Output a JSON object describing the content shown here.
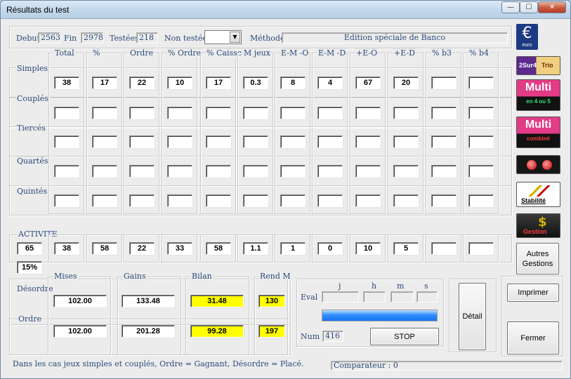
{
  "window": {
    "title": "Résultats du test",
    "min": "—",
    "max": "☐",
    "close": "✕"
  },
  "header": {
    "debut_label": "Debut",
    "debut": "2563",
    "fin_label": "Fin",
    "fin": "2978",
    "testees_label": "Testées",
    "testees": "218",
    "non_testees_label": "Non testées",
    "non_testees_value": "",
    "methode_label": "Méthode",
    "methode": "Edition spéciale de Banco"
  },
  "columns": [
    "Total",
    "%",
    "Ordre",
    "% Ordre",
    "% Caisse",
    "M jeux",
    "E-M -O",
    "E-M -D",
    "+E-O",
    "+E-D",
    "% b3",
    "% b4"
  ],
  "rows": [
    {
      "label": "Simples",
      "values": [
        "38",
        "17",
        "22",
        "10",
        "17",
        "0.3",
        "8",
        "4",
        "67",
        "20",
        "",
        ""
      ]
    },
    {
      "label": "Couplés",
      "values": [
        "",
        "",
        "",
        "",
        "",
        "",
        "",
        "",
        "",
        "",
        "",
        ""
      ]
    },
    {
      "label": "Tiercés",
      "values": [
        "",
        "",
        "",
        "",
        "",
        "",
        "",
        "",
        "",
        "",
        "",
        ""
      ]
    },
    {
      "label": "Quartés",
      "values": [
        "",
        "",
        "",
        "",
        "",
        "",
        "",
        "",
        "",
        "",
        "",
        ""
      ]
    },
    {
      "label": "Quintés",
      "values": [
        "",
        "",
        "",
        "",
        "",
        "",
        "",
        "",
        "",
        "",
        "",
        ""
      ]
    }
  ],
  "activite": {
    "label": "ACTIVITE",
    "count": "65",
    "pct": "15%",
    "values": [
      "38",
      "58",
      "22",
      "33",
      "58",
      "1.1",
      "1",
      "0",
      "10",
      "5",
      "",
      ""
    ]
  },
  "bottom": {
    "mises_label": "Mises",
    "gains_label": "Gains",
    "bilan_label": "Bilan",
    "rend_label": "Rend M",
    "desordre_label": "Désordre",
    "ordre_label": "Ordre",
    "desordre": {
      "mises": "102.00",
      "gains": "133.48",
      "bilan": "31.48",
      "rend": "130"
    },
    "ordre": {
      "mises": "102.00",
      "gains": "201.28",
      "bilan": "99.28",
      "rend": "197"
    }
  },
  "eval_panel": {
    "eval_label": "Eval",
    "j": "j",
    "h": "h",
    "m": "m",
    "s": "s",
    "num_label": "Num",
    "num": "416",
    "stop": "STOP",
    "progress": 1.0
  },
  "buttons": {
    "detail": "Détail",
    "imprimer": "Imprimer",
    "fermer": "Fermer",
    "autres": "Autres Gestions"
  },
  "side_icons": {
    "euro": "euro",
    "trio_a": "2Sur4",
    "trio_b": "Trio",
    "multi": "Multi",
    "multi_4": "en 4 ou 5",
    "multi_c": "combiné",
    "stabilite": "Stabilité",
    "gestion": "Gestion"
  },
  "footer": {
    "note": "Dans les cas jeux simples et couplés, Ordre = Gagnant, Désordre = Placé.",
    "comparateur": "Comparateur : 0"
  },
  "colors": {
    "accent": "#2a4a7a",
    "yellow": "#ffff00",
    "progress": "#2f8eff"
  }
}
